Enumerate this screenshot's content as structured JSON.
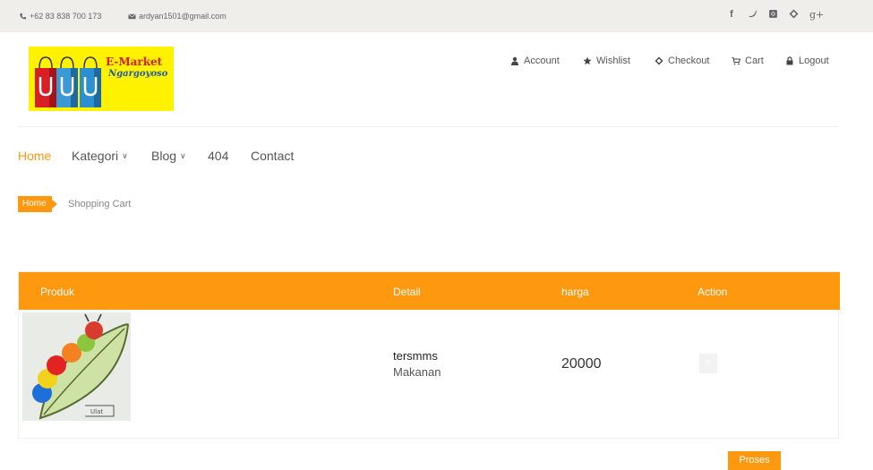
{
  "topbar": {
    "phone": "+62 83 838 700 173",
    "email": "ardyan1501@gmail.com",
    "social": [
      {
        "icon": "facebook-icon",
        "glyph": "f"
      },
      {
        "icon": "twitter-icon",
        "glyph": "t"
      },
      {
        "icon": "instagram-icon",
        "glyph": "i"
      },
      {
        "icon": "dribbble-icon",
        "glyph": "d"
      },
      {
        "icon": "google-plus-icon",
        "glyph": "g+"
      }
    ]
  },
  "logo": {
    "title": "E-Market",
    "subtitle": "Ngargoyoso"
  },
  "account_menu": {
    "account": "Account",
    "wishlist": "Wishlist",
    "checkout": "Checkout",
    "cart": "Cart",
    "logout": "Logout"
  },
  "nav": {
    "home": "Home",
    "kategori": "Kategori",
    "blog": "Blog",
    "p404": "404",
    "contact": "Contact"
  },
  "breadcrumb": {
    "home": "Home",
    "current": "Shopping Cart"
  },
  "cart": {
    "headers": {
      "produk": "Produk",
      "detail": "Detail",
      "harga": "harga",
      "action": "Action"
    },
    "items": [
      {
        "name": "tersmms",
        "category": "Makanan",
        "price": "20000",
        "delete_glyph": "✕"
      }
    ],
    "proses_label": "Proses"
  },
  "colors": {
    "accent": "#fe980f",
    "topbar_bg": "#efeeea"
  }
}
